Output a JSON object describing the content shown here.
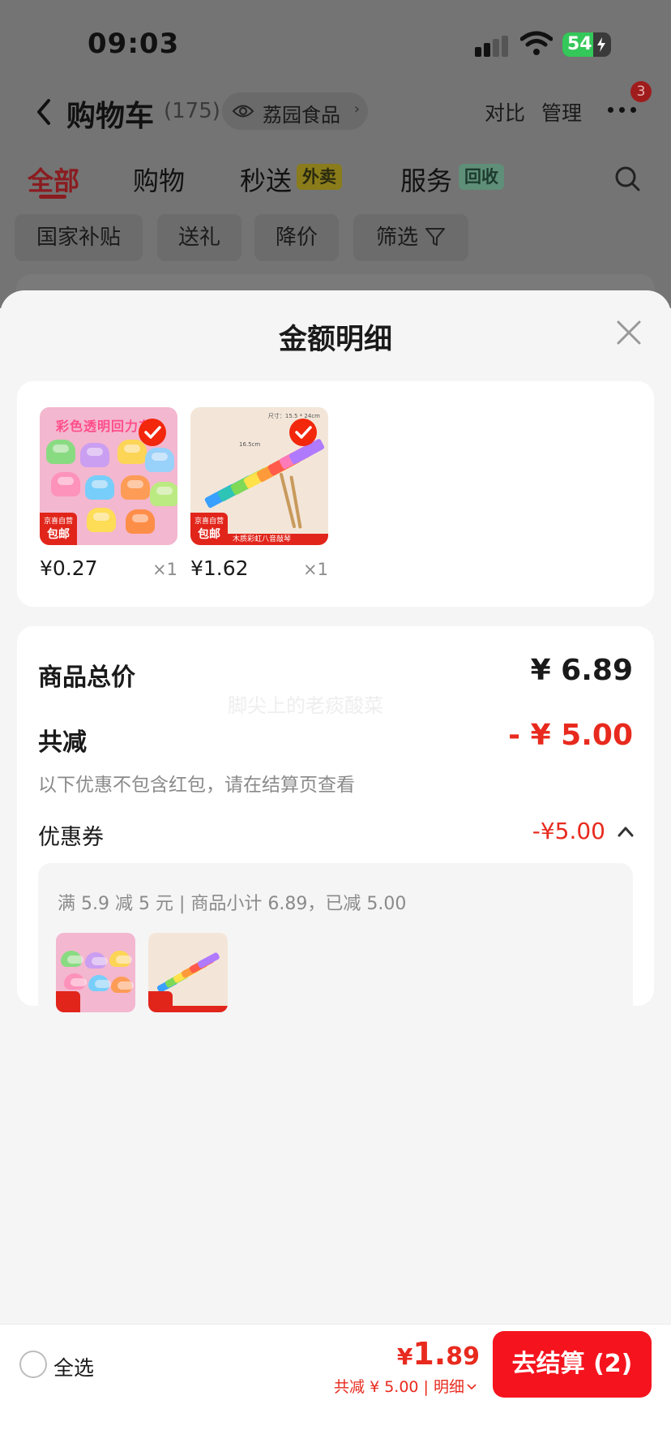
{
  "status_bar": {
    "time": "09:03",
    "battery": "54",
    "icons": [
      "signal-icon",
      "wifi-icon",
      "battery-charging-icon"
    ]
  },
  "nav": {
    "title": "购物车",
    "count": "(175)",
    "store_name": "荔园食品",
    "compare": "对比",
    "manage": "管理",
    "badge": "3",
    "icons": [
      "back-icon",
      "eye-icon",
      "more-icon"
    ]
  },
  "tabs": {
    "items": [
      {
        "label": "全部",
        "active": true
      },
      {
        "label": "购物"
      },
      {
        "label": "秒送",
        "tag": "外卖"
      },
      {
        "label": "服务",
        "tag": "回收"
      }
    ]
  },
  "chips": [
    "国家补贴",
    "送礼",
    "降价",
    "筛选"
  ],
  "sheet": {
    "title": "金额明细",
    "products": [
      {
        "name_text": "彩色透明回力车",
        "price": "¥0.27",
        "qty": "×1",
        "tag_top": "京喜自营",
        "tag_bottom": "包邮"
      },
      {
        "name_text": "木质彩虹八音敲琴",
        "price": "¥1.62",
        "qty": "×1",
        "tag_top": "京喜自营",
        "tag_bottom": "包邮",
        "size": "尺寸：15.5 * 24cm",
        "ruler": "16.5cm"
      }
    ],
    "summary": {
      "total_label": "商品总价",
      "total_value": "¥ 6.89",
      "watermark": "脚尖上的老痰酸菜",
      "reduce_label": "共减",
      "reduce_value": "- ¥ 5.00",
      "note": "以下优惠不包含红包，请在结算页查看",
      "coupon_label": "优惠券",
      "coupon_value": "-¥5.00",
      "coupon_desc": "满 5.9 减 5 元 | 商品小计 6.89，已减 5.00"
    }
  },
  "bottom_bar": {
    "select_all": "全选",
    "total_currency": "¥",
    "total_int": "1.",
    "total_dec": "89",
    "total_sub": "共减 ¥ 5.00 | 明细",
    "checkout": "去结算 (2)"
  },
  "colors": {
    "accent_red": "#e82a1e",
    "checkout_red": "#f5141e",
    "overlay": "#747474"
  }
}
